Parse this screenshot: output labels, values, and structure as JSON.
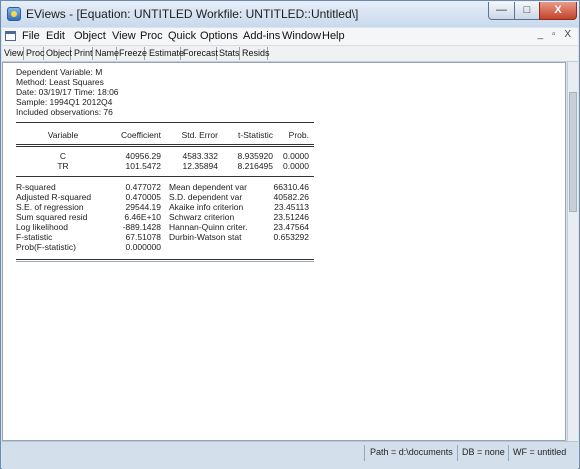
{
  "window": {
    "title": "EViews - [Equation: UNTITLED   Workfile: UNTITLED::Untitled\\]",
    "minimize": "—",
    "maximize": "□",
    "close": "X"
  },
  "menu": [
    "File",
    "Edit",
    "Object",
    "View",
    "Proc",
    "Quick",
    "Options",
    "Add-ins",
    "Window",
    "Help"
  ],
  "menu_mdi_controls": "_ ▫ X",
  "toolbar": [
    "View",
    "Proc",
    "Object",
    "Print",
    "Name",
    "Freeze",
    "Estimate",
    "Forecast",
    "Stats",
    "Resids"
  ],
  "header": {
    "dependent": "Dependent Variable: M",
    "method": "Method: Least Squares",
    "date": "Date: 03/19/17   Time: 18:06",
    "sample": "Sample: 1994Q1 2012Q4",
    "observations": "Included observations: 76"
  },
  "coef_table": {
    "columns": [
      "Variable",
      "Coefficient",
      "Std. Error",
      "t-Statistic",
      "Prob."
    ],
    "rows": [
      [
        "C",
        "40956.29",
        "4583.332",
        "8.935920",
        "0.0000"
      ],
      [
        "TR",
        "101.5472",
        "12.35894",
        "8.216495",
        "0.0000"
      ]
    ]
  },
  "stats": {
    "left": [
      [
        "R-squared",
        "0.477072"
      ],
      [
        "Adjusted R-squared",
        "0.470005"
      ],
      [
        "S.E. of regression",
        "29544.19"
      ],
      [
        "Sum squared resid",
        "6.46E+10"
      ],
      [
        "Log likelihood",
        "-889.1428"
      ],
      [
        "F-statistic",
        "67.51078"
      ],
      [
        "Prob(F-statistic)",
        "0.000000"
      ]
    ],
    "right": [
      [
        "Mean dependent var",
        "66310.46"
      ],
      [
        "S.D. dependent var",
        "40582.26"
      ],
      [
        "Akaike info criterion",
        "23.45113"
      ],
      [
        "Schwarz criterion",
        "23.51246"
      ],
      [
        "Hannan-Quinn criter.",
        "23.47564"
      ],
      [
        "Durbin-Watson stat",
        "0.653292"
      ]
    ]
  },
  "status": {
    "path": "Path = d:\\documents",
    "db": "DB = none",
    "wf": "WF = untitled"
  }
}
